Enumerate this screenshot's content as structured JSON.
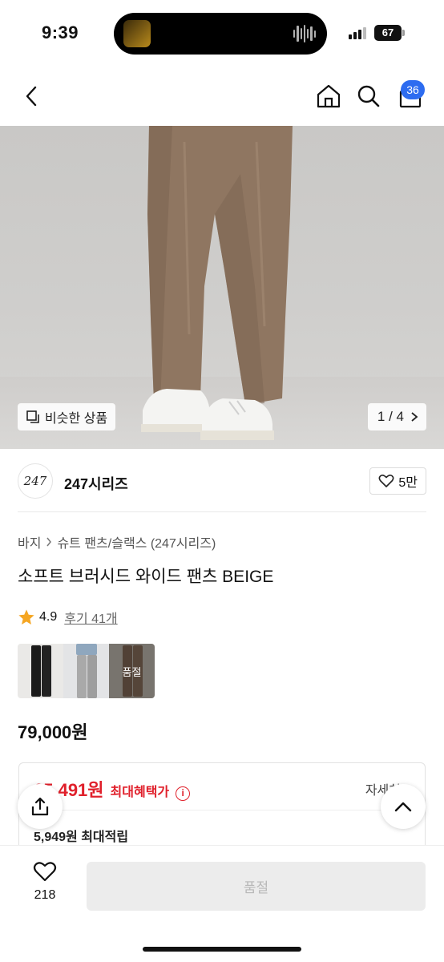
{
  "status_bar": {
    "time": "9:39",
    "battery": "67"
  },
  "header": {
    "cart_badge": "36"
  },
  "hero": {
    "similar_label": "비슷한 상품",
    "pager": "1 / 4"
  },
  "brand": {
    "logo_text": "247",
    "name": "247시리즈",
    "likes": "5만"
  },
  "breadcrumb": [
    "바지",
    "슈트 팬츠/슬랙스 (247시리즈)"
  ],
  "product": {
    "title": "소프트 브러시드 와이드 팬츠 BEIGE",
    "rating": "4.9",
    "review_link": "후기 41개",
    "swatch_soldout": "품절",
    "price": "79,000원"
  },
  "benefit": {
    "best_price": "65,491원",
    "best_label": "최대혜택가",
    "detail_link": "자세히",
    "points": "5,949원 최대적립"
  },
  "bottom_bar": {
    "wish_count": "218",
    "buy_button": "품절"
  },
  "colors": {
    "accent_red": "#e0202b",
    "badge_blue": "#2d6cf0"
  }
}
